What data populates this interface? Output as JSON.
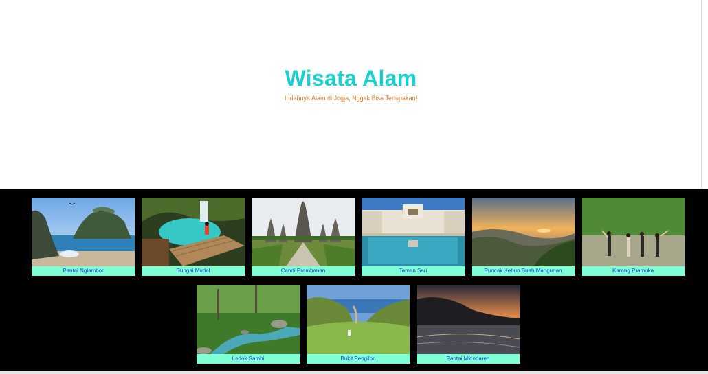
{
  "header": {
    "title": "Wisata Alam",
    "subtitle": "Indahnya Alam di Jogja, Nggak Bisa Terlupakan!"
  },
  "gallery": {
    "items": [
      {
        "label": "Pantai Nglambor"
      },
      {
        "label": "Sungai Mudal"
      },
      {
        "label": "Candi Prambanan"
      },
      {
        "label": "Taman Sari"
      },
      {
        "label": "Puncak Kebun Buah Mangunan"
      },
      {
        "label": "Karang Pramuka"
      },
      {
        "label": "Ledok Sambi"
      },
      {
        "label": "Bukit Pengilon"
      },
      {
        "label": "Pantai Midodaren"
      }
    ]
  },
  "colors": {
    "title": "#1ccfcf",
    "subtitle": "#e07b2a",
    "caption_bg": "#7fffd4",
    "caption_text": "#1a3fd6",
    "gallery_bg": "#000000"
  }
}
